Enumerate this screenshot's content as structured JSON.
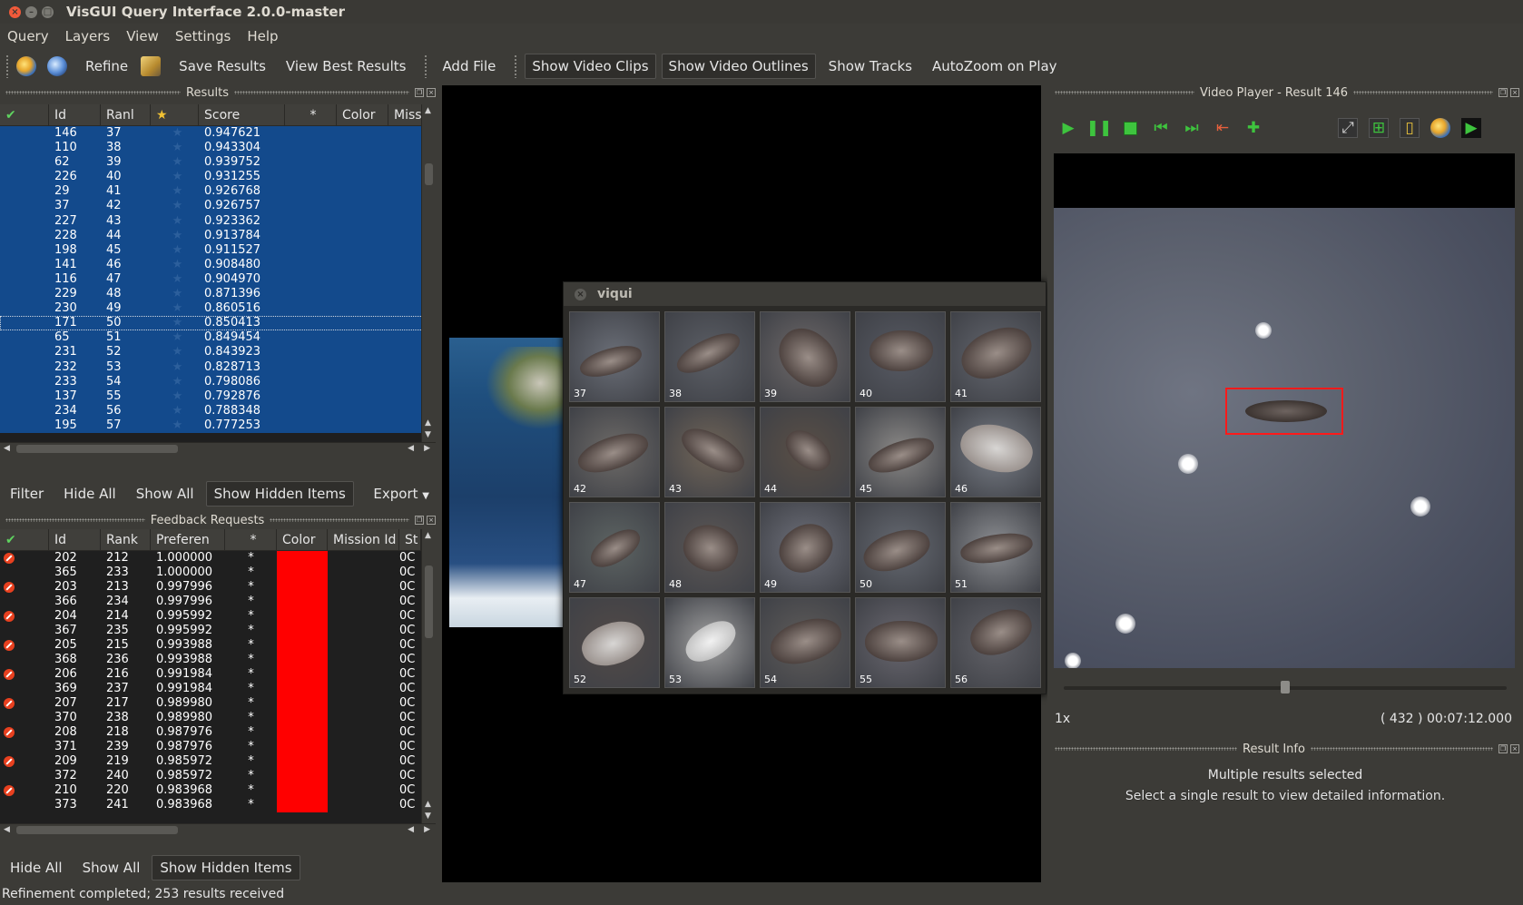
{
  "window": {
    "title": "VisGUI Query Interface 2.0.0-master"
  },
  "menubar": [
    "Query",
    "Layers",
    "View",
    "Settings",
    "Help"
  ],
  "toolbar": {
    "refine": "Refine",
    "save_results": "Save Results",
    "view_best": "View Best Results",
    "add_file": "Add File",
    "show_video_clips": "Show Video Clips",
    "show_video_outlines": "Show Video Outlines",
    "show_tracks": "Show Tracks",
    "autozoom": "AutoZoom on Play"
  },
  "results_panel": {
    "title": "Results",
    "columns": [
      "Id",
      "Ranl",
      "★",
      "Score",
      "*",
      "Color",
      "Mission"
    ],
    "rows": [
      {
        "id": "146",
        "rank": "37",
        "score": "0.947621"
      },
      {
        "id": "110",
        "rank": "38",
        "score": "0.943304"
      },
      {
        "id": "62",
        "rank": "39",
        "score": "0.939752"
      },
      {
        "id": "226",
        "rank": "40",
        "score": "0.931255"
      },
      {
        "id": "29",
        "rank": "41",
        "score": "0.926768"
      },
      {
        "id": "37",
        "rank": "42",
        "score": "0.926757"
      },
      {
        "id": "227",
        "rank": "43",
        "score": "0.923362"
      },
      {
        "id": "228",
        "rank": "44",
        "score": "0.913784"
      },
      {
        "id": "198",
        "rank": "45",
        "score": "0.911527"
      },
      {
        "id": "141",
        "rank": "46",
        "score": "0.908480"
      },
      {
        "id": "116",
        "rank": "47",
        "score": "0.904970"
      },
      {
        "id": "229",
        "rank": "48",
        "score": "0.871396"
      },
      {
        "id": "230",
        "rank": "49",
        "score": "0.860516"
      },
      {
        "id": "171",
        "rank": "50",
        "score": "0.850413"
      },
      {
        "id": "65",
        "rank": "51",
        "score": "0.849454"
      },
      {
        "id": "231",
        "rank": "52",
        "score": "0.843923"
      },
      {
        "id": "232",
        "rank": "53",
        "score": "0.828713"
      },
      {
        "id": "233",
        "rank": "54",
        "score": "0.798086"
      },
      {
        "id": "137",
        "rank": "55",
        "score": "0.792876"
      },
      {
        "id": "234",
        "rank": "56",
        "score": "0.788348"
      },
      {
        "id": "195",
        "rank": "57",
        "score": "0.777253"
      }
    ],
    "buttons": {
      "filter": "Filter",
      "hide_all": "Hide All",
      "show_all": "Show All",
      "show_hidden": "Show Hidden Items",
      "export": "Export"
    }
  },
  "feedback_panel": {
    "title": "Feedback Requests",
    "columns": [
      "Id",
      "Rank",
      "Preferen",
      "*",
      "Color",
      "Mission Id",
      "St"
    ],
    "rows": [
      {
        "id": "202",
        "rank": "212",
        "pref": "1.000000",
        "mark": true
      },
      {
        "id": "365",
        "rank": "233",
        "pref": "1.000000",
        "mark": false
      },
      {
        "id": "203",
        "rank": "213",
        "pref": "0.997996",
        "mark": true
      },
      {
        "id": "366",
        "rank": "234",
        "pref": "0.997996",
        "mark": false
      },
      {
        "id": "204",
        "rank": "214",
        "pref": "0.995992",
        "mark": true
      },
      {
        "id": "367",
        "rank": "235",
        "pref": "0.995992",
        "mark": false
      },
      {
        "id": "205",
        "rank": "215",
        "pref": "0.993988",
        "mark": true
      },
      {
        "id": "368",
        "rank": "236",
        "pref": "0.993988",
        "mark": false
      },
      {
        "id": "206",
        "rank": "216",
        "pref": "0.991984",
        "mark": true
      },
      {
        "id": "369",
        "rank": "237",
        "pref": "0.991984",
        "mark": false
      },
      {
        "id": "207",
        "rank": "217",
        "pref": "0.989980",
        "mark": true
      },
      {
        "id": "370",
        "rank": "238",
        "pref": "0.989980",
        "mark": false
      },
      {
        "id": "208",
        "rank": "218",
        "pref": "0.987976",
        "mark": true
      },
      {
        "id": "371",
        "rank": "239",
        "pref": "0.987976",
        "mark": false
      },
      {
        "id": "209",
        "rank": "219",
        "pref": "0.985972",
        "mark": true
      },
      {
        "id": "372",
        "rank": "240",
        "pref": "0.985972",
        "mark": false
      },
      {
        "id": "210",
        "rank": "220",
        "pref": "0.983968",
        "mark": true
      },
      {
        "id": "373",
        "rank": "241",
        "pref": "0.983968",
        "mark": false
      }
    ],
    "star": "*",
    "mission_prefix": "0C",
    "color_value": "#ff0000",
    "buttons": {
      "hide_all": "Hide All",
      "show_all": "Show All",
      "show_hidden": "Show Hidden Items"
    }
  },
  "viqui": {
    "title": "viqui",
    "thumbnails": [
      "37",
      "38",
      "39",
      "40",
      "41",
      "42",
      "43",
      "44",
      "45",
      "46",
      "47",
      "48",
      "49",
      "50",
      "51",
      "52",
      "53",
      "54",
      "55",
      "56"
    ]
  },
  "player": {
    "title": "Video Player - Result 146",
    "speed": "1x",
    "timecode": "( 432 ) 00:07:12.000",
    "slider_fraction": 0.5
  },
  "result_info": {
    "title": "Result Info",
    "main": "Multiple results selected",
    "sub": "Select a single result to view detailed information."
  },
  "status": "Refinement completed; 253 results received"
}
